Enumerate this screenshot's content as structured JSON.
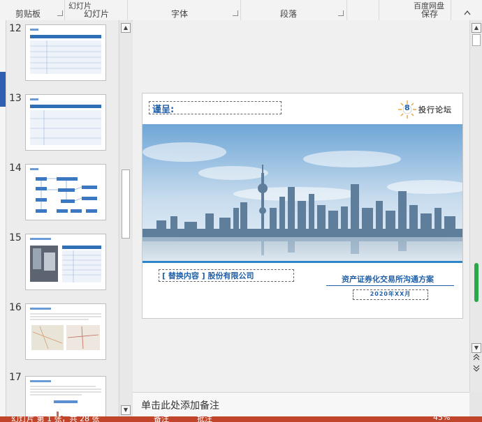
{
  "ribbon": {
    "groups": [
      "剪贴板",
      "幻灯片",
      "字体",
      "段落",
      "保存"
    ],
    "top_cut": [
      "幻灯片",
      "百度网盘"
    ]
  },
  "thumbnails": [
    {
      "num": "12"
    },
    {
      "num": "13"
    },
    {
      "num": "14"
    },
    {
      "num": "15"
    },
    {
      "num": "16"
    },
    {
      "num": "17"
    }
  ],
  "slide": {
    "recipient_label": "谨呈:",
    "brand_text": "投行论坛",
    "brand_mark": "8",
    "company": "[ 替换内容 ] 股份有限公司",
    "title": "资产证券化交易所沟通方案",
    "date": "2020年XX月"
  },
  "notes_placeholder": "单击此处添加备注",
  "status": {
    "slide_info": "幻灯片 第 1 张，共 28 张",
    "notes": "备注",
    "comments": "批注",
    "zoom": "45%"
  },
  "colors": {
    "accent_blue": "#1f5fa8",
    "status_bar": "#c0452a",
    "thumb_header": "#2e6fb5"
  }
}
